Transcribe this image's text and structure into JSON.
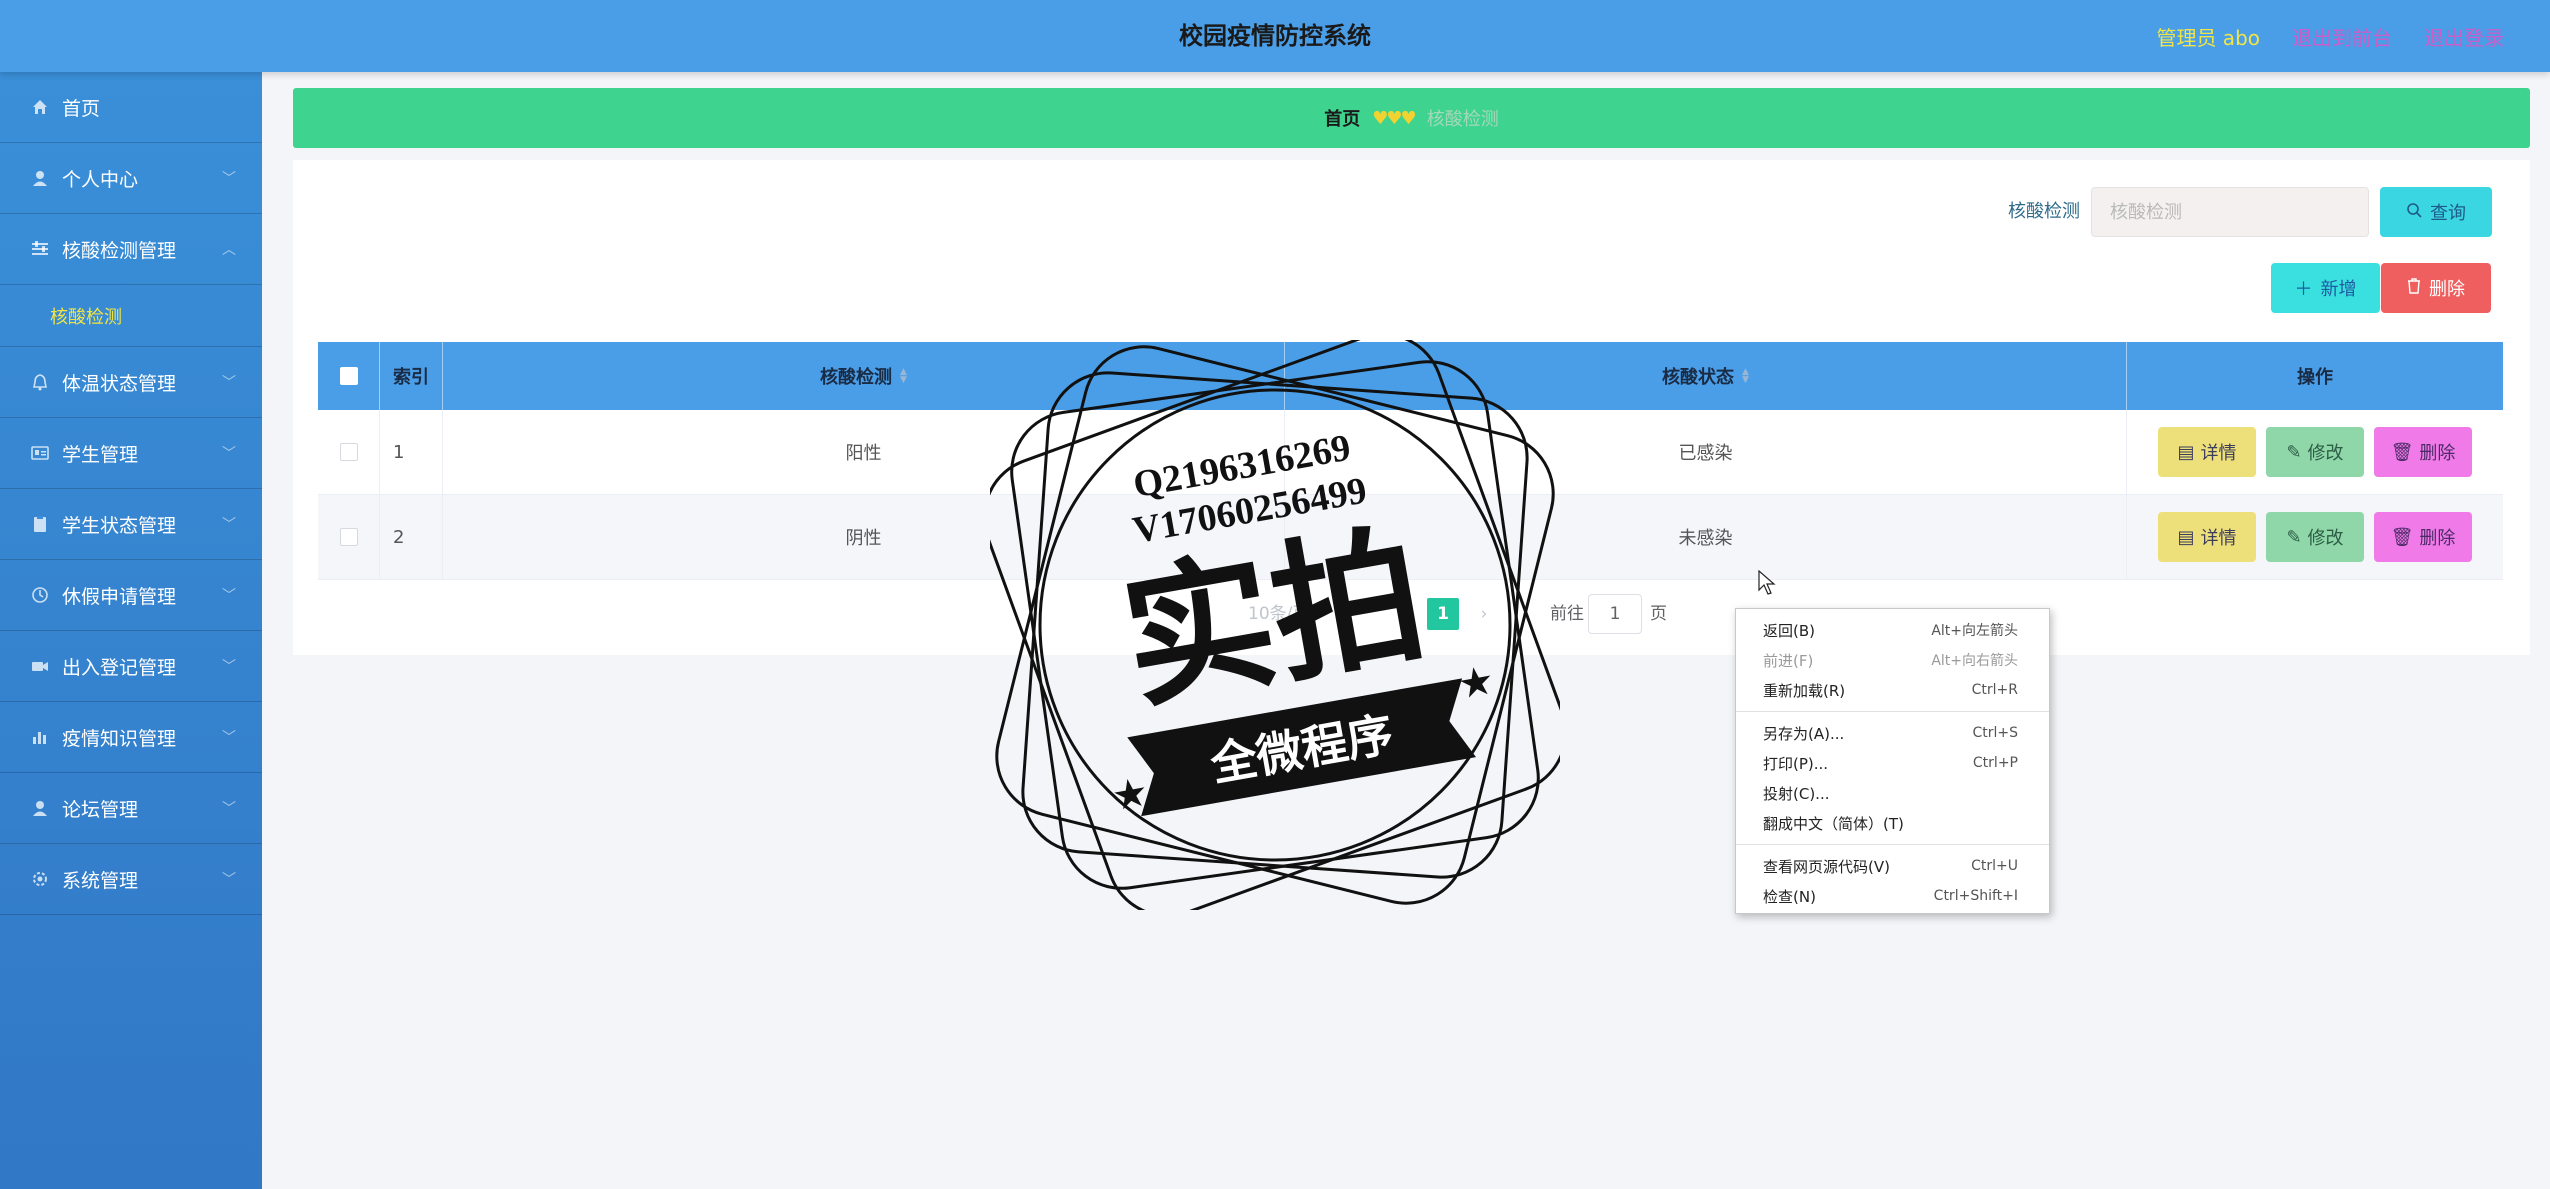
{
  "header": {
    "title": "校园疫情防控系统",
    "admin": "管理员 abo",
    "link_front": "退出到前台",
    "link_logout": "退出登录"
  },
  "sidebar": {
    "items": [
      {
        "label": "首页",
        "icon": "home-icon"
      },
      {
        "label": "个人中心",
        "icon": "user-icon"
      },
      {
        "label": "核酸检测管理",
        "icon": "sliders-icon",
        "expanded": true
      },
      {
        "label": "体温状态管理",
        "icon": "bell-icon"
      },
      {
        "label": "学生管理",
        "icon": "id-card-icon"
      },
      {
        "label": "学生状态管理",
        "icon": "clipboard-icon"
      },
      {
        "label": "休假申请管理",
        "icon": "clock-icon"
      },
      {
        "label": "出入登记管理",
        "icon": "camera-icon"
      },
      {
        "label": "疫情知识管理",
        "icon": "chart-icon"
      },
      {
        "label": "论坛管理",
        "icon": "user-icon"
      },
      {
        "label": "系统管理",
        "icon": "gear-icon"
      }
    ],
    "sub_item": "核酸检测"
  },
  "breadcrumb": {
    "home": "首页",
    "hearts": "♥♥♥",
    "current": "核酸检测"
  },
  "search": {
    "label": "核酸检测",
    "placeholder": "核酸检测",
    "button": "查询"
  },
  "actions": {
    "add": "新增",
    "delete": "删除"
  },
  "table": {
    "headers": {
      "index": "索引",
      "test": "核酸检测",
      "state": "核酸状态",
      "ops": "操作"
    },
    "rows": [
      {
        "index": "1",
        "test": "阳性",
        "state": "已感染"
      },
      {
        "index": "2",
        "test": "阴性",
        "state": "未感染"
      }
    ],
    "op_labels": {
      "detail": "详情",
      "edit": "修改",
      "delete": "删除"
    }
  },
  "pagination": {
    "page_size": "10条/页",
    "current_page": "1",
    "goto_label": "前往",
    "goto_value": "1",
    "unit": "页"
  },
  "watermark": {
    "line1": "Q2196316269",
    "line2": "V17060256499",
    "big": "实拍",
    "ribbon": "全微程序"
  },
  "context_menu": {
    "items": [
      {
        "label": "返回(B)",
        "shortcut": "Alt+向左箭头"
      },
      {
        "label": "前进(F)",
        "shortcut": "Alt+向右箭头",
        "disabled": true
      },
      {
        "label": "重新加载(R)",
        "shortcut": "Ctrl+R"
      },
      {
        "label": "另存为(A)...",
        "shortcut": "Ctrl+S"
      },
      {
        "label": "打印(P)...",
        "shortcut": "Ctrl+P"
      },
      {
        "label": "投射(C)...",
        "shortcut": ""
      },
      {
        "label": "翻成中文（简体）(T)",
        "shortcut": ""
      },
      {
        "label": "查看网页源代码(V)",
        "shortcut": "Ctrl+U"
      },
      {
        "label": "检查(N)",
        "shortcut": "Ctrl+Shift+I"
      }
    ]
  }
}
